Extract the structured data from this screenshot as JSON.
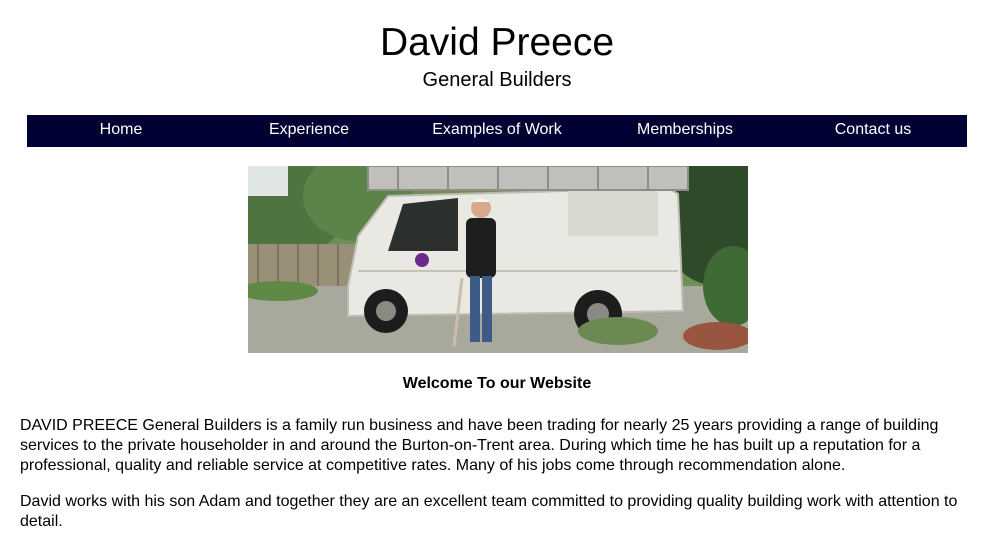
{
  "header": {
    "title": "David Preece",
    "subtitle": "General Builders"
  },
  "nav": {
    "items": [
      {
        "label": "Home"
      },
      {
        "label": "Experience"
      },
      {
        "label": "Examples of Work"
      },
      {
        "label": "Memberships"
      },
      {
        "label": "Contact us"
      }
    ],
    "background_color": "#000033"
  },
  "hero": {
    "image_subject": "man standing beside white van with ladders on roof"
  },
  "main": {
    "welcome_heading": "Welcome To our Website",
    "paragraphs": [
      "DAVID PREECE General Builders is a family run business and have been trading for nearly 25 years providing a range of building services to the private householder in and around the Burton-on-Trent area. During which time he has built up a reputation for a professional, quality and reliable service at competitive rates. Many of his jobs come through recommendation alone.",
      "David works with his son Adam and together they are an excellent team committed to providing quality building work with attention to detail."
    ]
  }
}
